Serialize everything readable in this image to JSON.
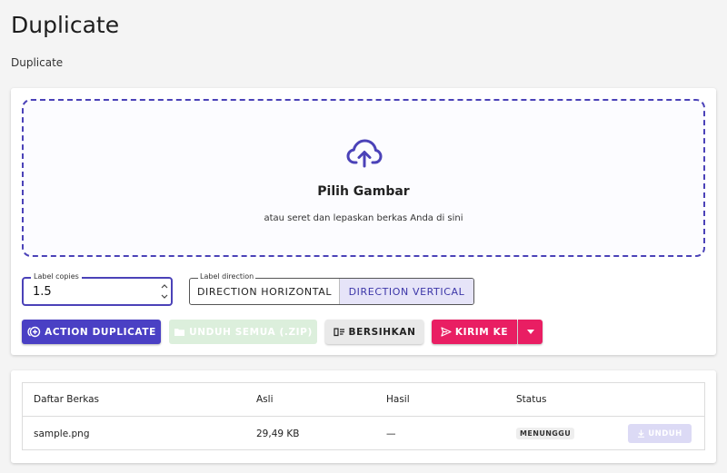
{
  "header": {
    "title": "Duplicate",
    "breadcrumb": "Duplicate"
  },
  "dropzone": {
    "title": "Pilih Gambar",
    "subtitle": "atau seret dan lepaskan berkas Anda di sini",
    "icon": "cloud-upload-icon"
  },
  "copies_field": {
    "label": "Label copies",
    "value": "1.5"
  },
  "direction_toggle": {
    "label": "Label direction",
    "options": [
      "DIRECTION HORIZONTAL",
      "DIRECTION VERTICAL"
    ],
    "selected": "DIRECTION VERTICAL"
  },
  "actions": {
    "duplicate": "ACTION DUPLICATE",
    "download_all": "UNDUH SEMUA (.ZIP)",
    "clear": "BERSIHKAN",
    "send_to": "KIRIM KE"
  },
  "files_table": {
    "columns": [
      "Daftar Berkas",
      "Asli",
      "Hasil",
      "Status"
    ],
    "rows": [
      {
        "name": "sample.png",
        "original": "29,49 KB",
        "result": "—",
        "status": "MENUNGGU",
        "action": "UNDUH"
      }
    ]
  },
  "colors": {
    "primary": "#4a40c4",
    "accent": "#e91e63",
    "success_disabled": "#dcefdc"
  }
}
